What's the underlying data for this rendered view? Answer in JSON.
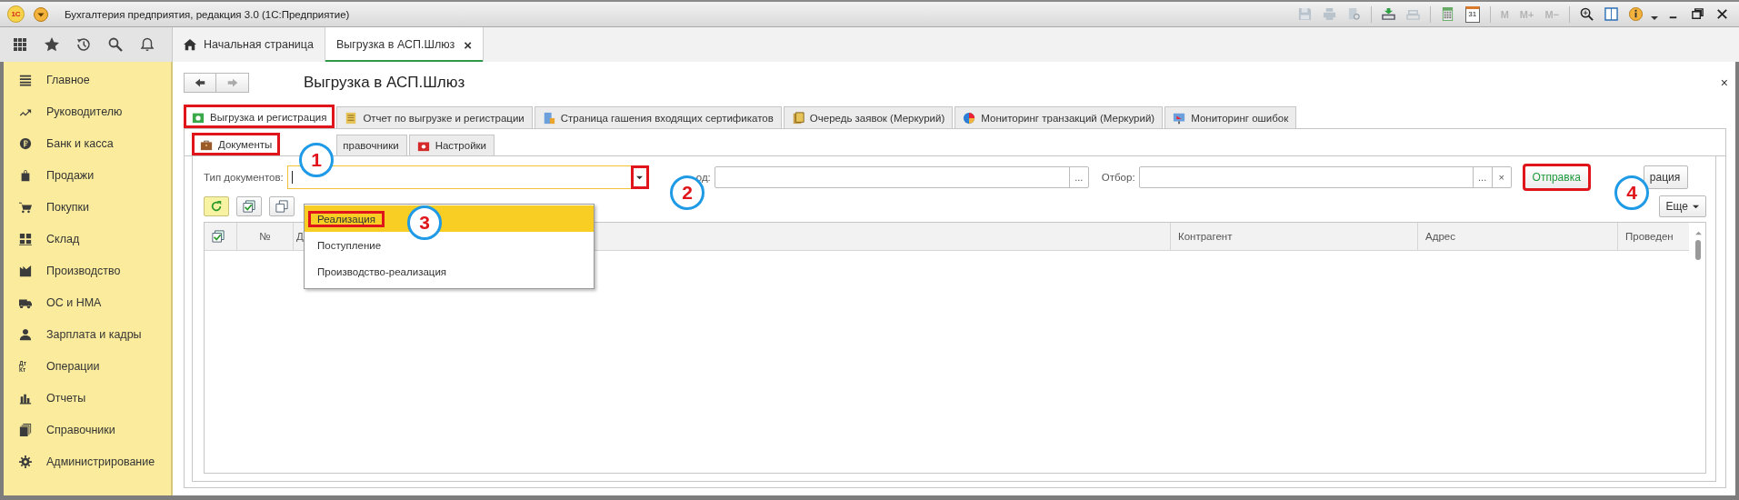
{
  "window": {
    "title": "Бухгалтерия предприятия, редакция 3.0  (1С:Предприятие)",
    "logo": "1С",
    "calendar_day": "31",
    "memory_buttons": [
      {
        "label": "M",
        "disabled": true
      },
      {
        "label": "M+",
        "disabled": true
      },
      {
        "label": "M−",
        "disabled": true
      }
    ]
  },
  "nav_tabs": [
    {
      "label": "Начальная страница",
      "selected": false
    },
    {
      "label": "Выгрузка в АСП.Шлюз",
      "selected": true,
      "close": "×"
    }
  ],
  "sidebar": {
    "items": [
      {
        "label": "Главное"
      },
      {
        "label": "Руководителю"
      },
      {
        "label": "Банк и касса"
      },
      {
        "label": "Продажи"
      },
      {
        "label": "Покупки"
      },
      {
        "label": "Склад"
      },
      {
        "label": "Производство"
      },
      {
        "label": "ОС и НМА"
      },
      {
        "label": "Зарплата и кадры"
      },
      {
        "label": "Операции",
        "icon_text": "Дт Кт"
      },
      {
        "label": "Отчеты"
      },
      {
        "label": "Справочники"
      },
      {
        "label": "Администрирование"
      }
    ]
  },
  "form": {
    "title": "Выгрузка в АСП.Шлюз",
    "close": "×",
    "tabs": [
      {
        "label": "Выгрузка и регистрация",
        "selected": true,
        "highlighted": true
      },
      {
        "label": "Отчет по выгрузке и регистрации",
        "selected": false,
        "highlighted": false
      },
      {
        "label": "Страница гашения входящих сертификатов",
        "selected": false,
        "highlighted": false
      },
      {
        "label": "Очередь заявок (Меркурий)",
        "selected": false,
        "highlighted": false
      },
      {
        "label": "Мониторинг транзакций (Меркурий)",
        "selected": false,
        "highlighted": false
      },
      {
        "label": "Мониторинг ошибок",
        "selected": false,
        "highlighted": false
      }
    ],
    "subtabs": [
      {
        "label": "Документы",
        "selected": true,
        "highlighted": true
      },
      {
        "label": "правочники",
        "selected": false,
        "highlighted": false
      },
      {
        "label": "Настройки",
        "selected": false,
        "highlighted": false
      }
    ],
    "doc_type": {
      "label": "Тип документов:",
      "arrow_highlighted": true
    },
    "period": {
      "label": "од:",
      "button": "..."
    },
    "selection": {
      "label": "Отбор:",
      "button": "...",
      "clear": "×"
    },
    "actions": [
      {
        "label": "Отправка",
        "highlighted": true,
        "color": "#1f9a3c"
      },
      {
        "label": "рация",
        "highlighted": false,
        "color": "#333333"
      }
    ],
    "more_button": "Еще",
    "dropdown": {
      "items": [
        {
          "label": "Реализация",
          "selected": true,
          "highlighted": true
        },
        {
          "label": "Поступление",
          "selected": false,
          "highlighted": false
        },
        {
          "label": "Производство-реализация",
          "selected": false,
          "highlighted": false
        }
      ]
    },
    "table": {
      "columns": [
        "№",
        "Д",
        "Контрагент",
        "Адрес",
        "Проведен"
      ]
    }
  },
  "annotations": [
    {
      "label": "1"
    },
    {
      "label": "2"
    },
    {
      "label": "3"
    },
    {
      "label": "4"
    }
  ]
}
